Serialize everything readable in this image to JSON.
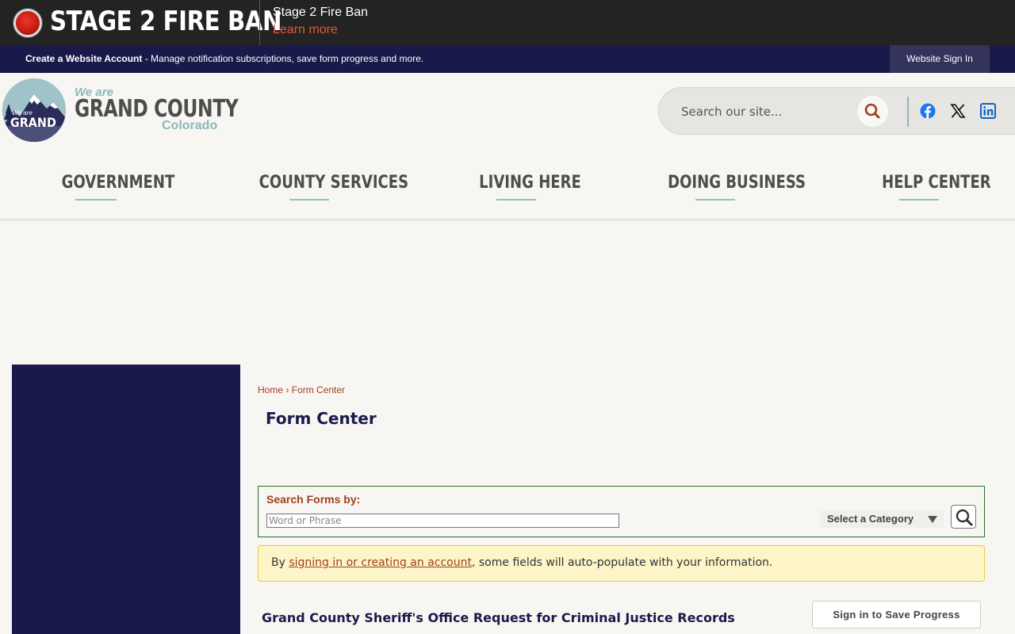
{
  "alert": {
    "title": "STAGE 2 FIRE BAN",
    "subtitle": "Stage 2 Fire Ban",
    "link": "Learn more"
  },
  "account_bar": {
    "create_link": "Create a Website Account",
    "description": " - Manage notification subscriptions, save form progress and more.",
    "signin": "Website Sign In"
  },
  "logo": {
    "we_are": "We are",
    "county": "GRAND COUNTY",
    "state": "Colorado",
    "badge_we_are": "We are",
    "badge_grand": "GRAND"
  },
  "search": {
    "placeholder": "Search our site..."
  },
  "social": [
    "facebook-icon",
    "x-icon",
    "linkedin-icon"
  ],
  "nav": [
    {
      "label": "GOVERNMENT"
    },
    {
      "label": "COUNTY SERVICES"
    },
    {
      "label": "LIVING HERE"
    },
    {
      "label": "DOING BUSINESS"
    },
    {
      "label": "HELP CENTER"
    }
  ],
  "breadcrumb": {
    "home": "Home",
    "separator": "›",
    "current": "Form Center"
  },
  "page_title": "Form Center",
  "form_search": {
    "label": "Search Forms by:",
    "placeholder": "Word or Phrase",
    "category": "Select a Category"
  },
  "notice": {
    "prefix": "By ",
    "link": "signing in or creating an account",
    "suffix": ", some fields will auto-populate with your information."
  },
  "form": {
    "title": "Grand County Sheriff's Office Request for Criminal Justice Records",
    "save_button": "Sign in to Save Progress"
  },
  "colors": {
    "navy": "#1a1a4a",
    "rust": "#a0411e",
    "teal": "#8eb7bd",
    "alert_red": "#e8563a"
  }
}
